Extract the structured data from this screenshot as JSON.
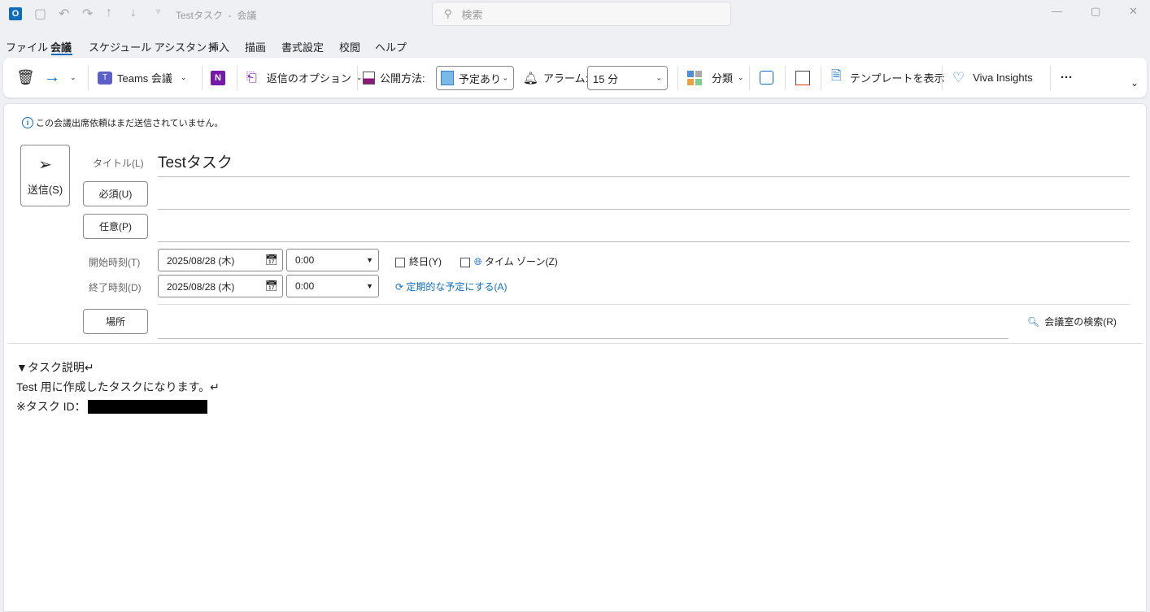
{
  "titlebar": {
    "title": "Testタスク  -  会議",
    "search_placeholder": "検索"
  },
  "menu": [
    "ファイル",
    "会議",
    "スケジュール アシスタント",
    "挿入",
    "描画",
    "書式設定",
    "校閲",
    "ヘルプ"
  ],
  "ribbon": {
    "teams": "Teams 会議",
    "reply_options": "返信のオプション",
    "show_as_label": "公開方法:",
    "show_as_value": "予定あり",
    "alarm_label": "アラーム:",
    "alarm_value": "15 分",
    "categorize": "分類",
    "template": "テンプレートを表示",
    "viva": "Viva Insights",
    "more": "···"
  },
  "colors": {
    "accent": "#0f6cbd",
    "busy": "#7ab8e8"
  },
  "form": {
    "info": "この会議出席依頼はまだ送信されていません。",
    "send": "送信(S)",
    "title_label": "タイトル(L)",
    "title_value": "Testタスク",
    "required": "必須(U)",
    "optional": "任意(P)",
    "start_label": "開始時刻(T)",
    "start_date": "2025/08/28 (木)",
    "start_time": "0:00",
    "end_label": "終了時刻(D)",
    "end_date": "2025/08/28 (木)",
    "end_time": "0:00",
    "all_day": "終日(Y)",
    "time_zone": "タイム ゾーン(Z)",
    "recurring": "定期的な予定にする(A)",
    "location": "場所",
    "room_finder": "会議室の検索(R)"
  },
  "body": {
    "line1": "▼タスク説明↵",
    "line2": "Test 用に作成したタスクになります。↵",
    "line3": "※タスク ID："
  }
}
